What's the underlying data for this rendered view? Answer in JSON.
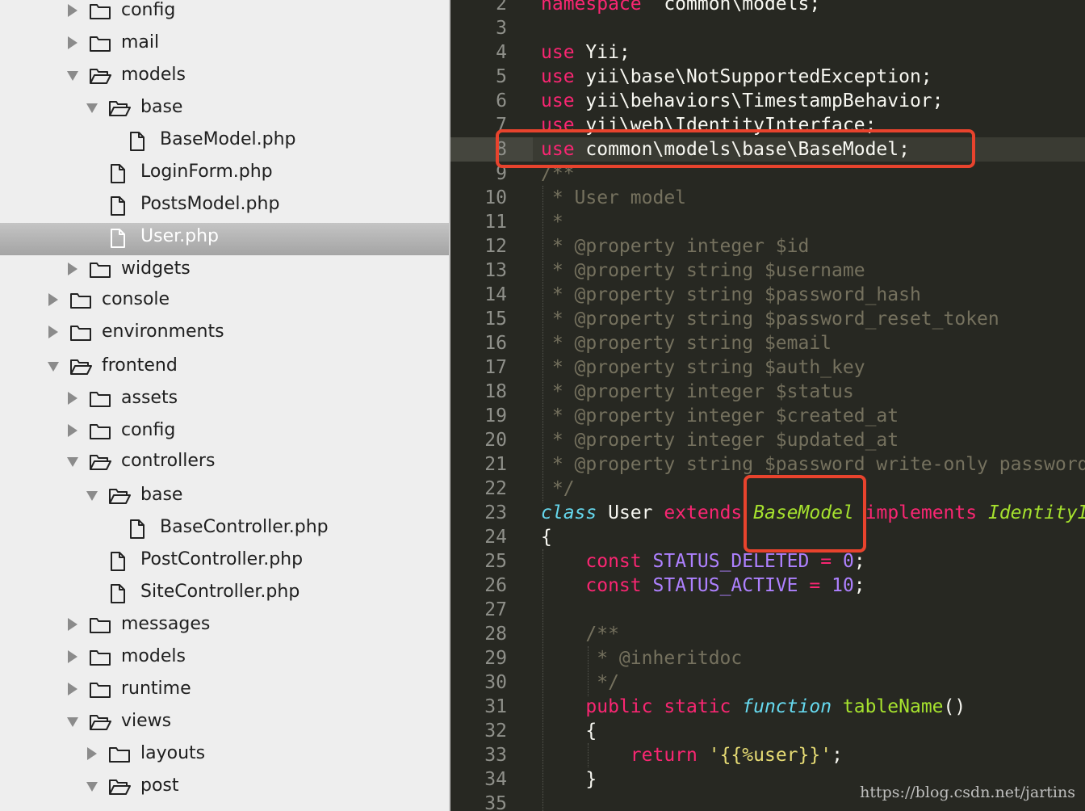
{
  "sidebar": {
    "rows": [
      {
        "label": "config",
        "kind": "folder",
        "expanded": false,
        "depth": 1
      },
      {
        "label": "mail",
        "kind": "folder",
        "expanded": false,
        "depth": 1
      },
      {
        "label": "models",
        "kind": "folder",
        "expanded": true,
        "depth": 1
      },
      {
        "label": "base",
        "kind": "folder",
        "expanded": true,
        "depth": 2
      },
      {
        "label": "BaseModel.php",
        "kind": "file",
        "depth": 3
      },
      {
        "label": "LoginForm.php",
        "kind": "file",
        "depth": 2
      },
      {
        "label": "PostsModel.php",
        "kind": "file",
        "depth": 2
      },
      {
        "label": "User.php",
        "kind": "file",
        "depth": 2,
        "selected": true
      },
      {
        "label": "widgets",
        "kind": "folder",
        "expanded": false,
        "depth": 1
      },
      {
        "label": "console",
        "kind": "folder",
        "expanded": false,
        "depth": 0
      },
      {
        "label": "environments",
        "kind": "folder",
        "expanded": false,
        "depth": 0
      },
      {
        "label": "frontend",
        "kind": "folder",
        "expanded": true,
        "depth": 0
      },
      {
        "label": "assets",
        "kind": "folder",
        "expanded": false,
        "depth": 1
      },
      {
        "label": "config",
        "kind": "folder",
        "expanded": false,
        "depth": 1
      },
      {
        "label": "controllers",
        "kind": "folder",
        "expanded": true,
        "depth": 1
      },
      {
        "label": "base",
        "kind": "folder",
        "expanded": true,
        "depth": 2
      },
      {
        "label": "BaseController.php",
        "kind": "file",
        "depth": 3
      },
      {
        "label": "PostController.php",
        "kind": "file",
        "depth": 2
      },
      {
        "label": "SiteController.php",
        "kind": "file",
        "depth": 2
      },
      {
        "label": "messages",
        "kind": "folder",
        "expanded": false,
        "depth": 1
      },
      {
        "label": "models",
        "kind": "folder",
        "expanded": false,
        "depth": 1
      },
      {
        "label": "runtime",
        "kind": "folder",
        "expanded": false,
        "depth": 1
      },
      {
        "label": "views",
        "kind": "folder",
        "expanded": true,
        "depth": 1
      },
      {
        "label": "layouts",
        "kind": "folder",
        "expanded": false,
        "depth": 2
      },
      {
        "label": "post",
        "kind": "folder",
        "expanded": true,
        "depth": 2
      }
    ]
  },
  "editor": {
    "first_line_number": 2,
    "current_line": 8,
    "lines": [
      [
        [
          "kw",
          "namespace"
        ],
        [
          "",
          "  common\\models;"
        ]
      ],
      [],
      [
        [
          "kw",
          "use"
        ],
        [
          "",
          " Yii;"
        ]
      ],
      [
        [
          "kw",
          "use"
        ],
        [
          "",
          " yii\\base\\NotSupportedException;"
        ]
      ],
      [
        [
          "kw",
          "use"
        ],
        [
          "",
          " yii\\behaviors\\TimestampBehavior;"
        ]
      ],
      [
        [
          "kw",
          "use"
        ],
        [
          "",
          " yii\\web\\IdentityInterface;"
        ]
      ],
      [
        [
          "kw",
          "use"
        ],
        [
          "",
          " common\\models\\base\\BaseModel;"
        ]
      ],
      [
        [
          "cmt",
          "/**"
        ]
      ],
      [
        [
          "cmt",
          " * User model"
        ]
      ],
      [
        [
          "cmt",
          " *"
        ]
      ],
      [
        [
          "cmt",
          " * @property integer $id"
        ]
      ],
      [
        [
          "cmt",
          " * @property string $username"
        ]
      ],
      [
        [
          "cmt",
          " * @property string $password_hash"
        ]
      ],
      [
        [
          "cmt",
          " * @property string $password_reset_token"
        ]
      ],
      [
        [
          "cmt",
          " * @property string $email"
        ]
      ],
      [
        [
          "cmt",
          " * @property string $auth_key"
        ]
      ],
      [
        [
          "cmt",
          " * @property integer $status"
        ]
      ],
      [
        [
          "cmt",
          " * @property integer $created_at"
        ]
      ],
      [
        [
          "cmt",
          " * @property integer $updated_at"
        ]
      ],
      [
        [
          "cmt",
          " * @property string $password write-only password"
        ]
      ],
      [
        [
          "cmt",
          " */"
        ]
      ],
      [
        [
          "it",
          "class"
        ],
        [
          "",
          " User "
        ],
        [
          "kw",
          "extends"
        ],
        [
          "",
          " "
        ],
        [
          "ent",
          "BaseModel"
        ],
        [
          "",
          " "
        ],
        [
          "kw",
          "implements"
        ],
        [
          "",
          " "
        ],
        [
          "ent",
          "IdentityInterface"
        ]
      ],
      [
        [
          "",
          "{"
        ]
      ],
      [
        [
          "",
          "    "
        ],
        [
          "kw",
          "const"
        ],
        [
          "",
          " "
        ],
        [
          "cnst",
          "STATUS_DELETED"
        ],
        [
          "",
          " "
        ],
        [
          "kw",
          "="
        ],
        [
          "",
          " "
        ],
        [
          "cnst",
          "0"
        ],
        [
          "",
          ";"
        ]
      ],
      [
        [
          "",
          "    "
        ],
        [
          "kw",
          "const"
        ],
        [
          "",
          " "
        ],
        [
          "cnst",
          "STATUS_ACTIVE"
        ],
        [
          "",
          " "
        ],
        [
          "kw",
          "="
        ],
        [
          "",
          " "
        ],
        [
          "cnst",
          "10"
        ],
        [
          "",
          ";"
        ]
      ],
      [],
      [
        [
          "",
          "    "
        ],
        [
          "cmt",
          "/**"
        ]
      ],
      [
        [
          "",
          "    "
        ],
        [
          "cmt",
          " * @inheritdoc"
        ]
      ],
      [
        [
          "",
          "    "
        ],
        [
          "cmt",
          " */"
        ]
      ],
      [
        [
          "",
          "    "
        ],
        [
          "kw",
          "public static"
        ],
        [
          "",
          " "
        ],
        [
          "it",
          "function"
        ],
        [
          "",
          " "
        ],
        [
          "fn",
          "tableName"
        ],
        [
          "",
          "()"
        ]
      ],
      [
        [
          "",
          "    {"
        ]
      ],
      [
        [
          "",
          "        "
        ],
        [
          "kw",
          "return"
        ],
        [
          "",
          " "
        ],
        [
          "str",
          "'{{%user}}'"
        ],
        [
          "",
          ";"
        ]
      ],
      [
        [
          "",
          "    }"
        ]
      ],
      []
    ]
  },
  "annotations": {
    "color": "#e8432d",
    "boxes": [
      "use-basemodel-line",
      "extends-basemodel"
    ]
  },
  "watermark": "https://blog.csdn.net/jartins"
}
